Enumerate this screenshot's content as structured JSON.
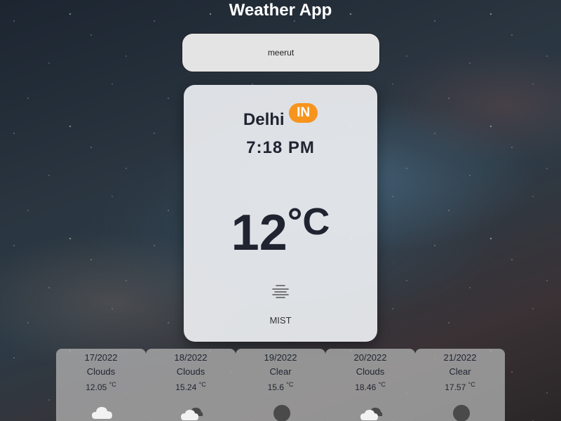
{
  "app": {
    "title": "Weather App"
  },
  "search": {
    "value": "meerut"
  },
  "current": {
    "city": "Delhi",
    "country": "IN",
    "time": "7:18 PM",
    "temperature": "12",
    "unit": "°C",
    "description": "MIST",
    "icon": "mist-icon"
  },
  "forecast": [
    {
      "date": "17/2022",
      "condition": "Clouds",
      "temp": "12.05",
      "unit": "°C",
      "icon": "cloud-icon"
    },
    {
      "date": "18/2022",
      "condition": "Clouds",
      "temp": "15.24",
      "unit": "°C",
      "icon": "broken-clouds-icon"
    },
    {
      "date": "19/2022",
      "condition": "Clear",
      "temp": "15.6",
      "unit": "°C",
      "icon": "moon-icon"
    },
    {
      "date": "20/2022",
      "condition": "Clouds",
      "temp": "18.46",
      "unit": "°C",
      "icon": "broken-clouds-icon"
    },
    {
      "date": "21/2022",
      "condition": "Clear",
      "temp": "17.57",
      "unit": "°C",
      "icon": "moon-icon"
    }
  ],
  "colors": {
    "country_badge": "#f7941d",
    "card_bg": "#eceef1",
    "text_dark": "#1f2430"
  }
}
